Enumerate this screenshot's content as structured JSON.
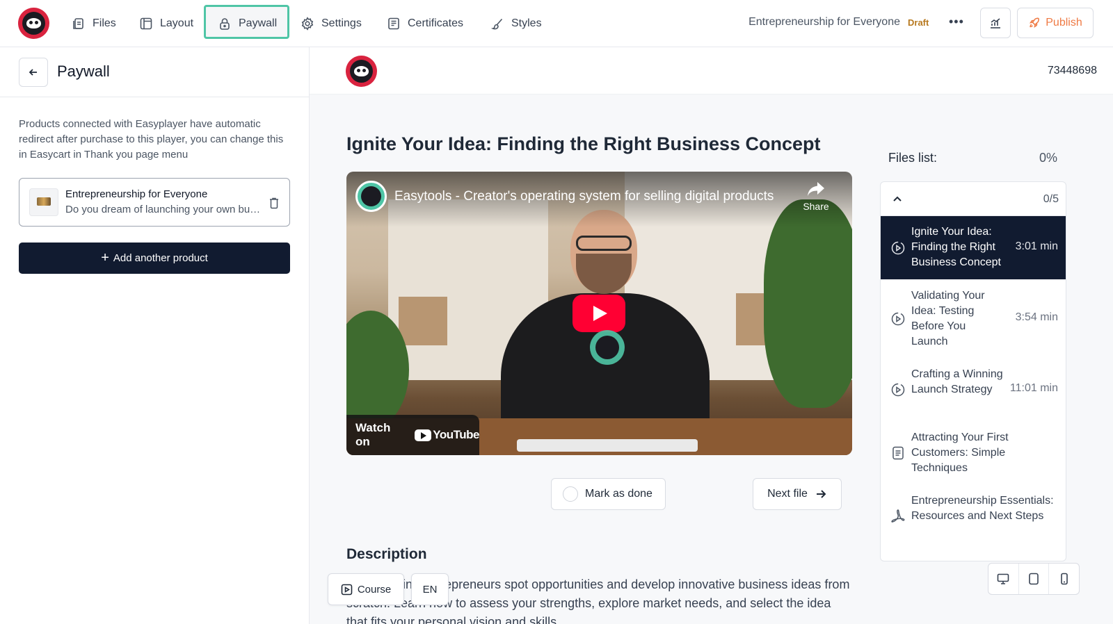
{
  "topbar": {
    "nav": [
      {
        "label": "Files",
        "icon": "files-icon"
      },
      {
        "label": "Layout",
        "icon": "layout-icon"
      },
      {
        "label": "Paywall",
        "icon": "lock-icon",
        "active": true
      },
      {
        "label": "Settings",
        "icon": "gear-icon"
      },
      {
        "label": "Certificates",
        "icon": "certificate-icon"
      },
      {
        "label": "Styles",
        "icon": "brush-icon"
      }
    ],
    "course_title": "Entrepreneurship for Everyone",
    "status_badge": "Draft",
    "more_label": "•••",
    "publish_label": "Publish",
    "accent_color": "#4fc5a6",
    "publish_color": "#ef7a44"
  },
  "left_panel": {
    "title": "Paywall",
    "info_text": "Products connected with Easyplayer have automatic redirect after purchase to this player, you can change this in Easycart in Thank you page menu",
    "product": {
      "name": "Entrepreneurship for Everyone",
      "description": "Do you dream of launching your own business and becoming an entrepreneur?"
    },
    "add_product_label": "Add another product",
    "add_product_plus": "+"
  },
  "preview": {
    "id": "73448698",
    "lesson_title": "Ignite Your Idea: Finding the Right Business Concept",
    "video": {
      "title": "Easytools - Creator's operating system for selling digital products",
      "share_label": "Share",
      "watch_on_label": "Watch on",
      "youtube_label": "YouTube"
    },
    "mark_done_label": "Mark as done",
    "next_file_label": "Next file",
    "description_title": "Description",
    "description_text": "Help aspiring entrepreneurs spot opportunities and develop innovative business ideas from scratch. Learn how to assess your strengths, explore market needs, and select the idea that fits your personal vision and skills.",
    "floating": {
      "course_label": "Course",
      "language_label": "EN"
    },
    "files": {
      "heading": "Files list:",
      "progress": "0%",
      "count": "0/5",
      "items": [
        {
          "name": "Ignite Your Idea: Finding the Right Business Concept",
          "duration": "3:01 min",
          "icon": "video-play-icon",
          "active": true
        },
        {
          "name": "Validating Your Idea: Testing Before You Launch",
          "duration": "3:54 min",
          "icon": "video-play-icon",
          "active": false
        },
        {
          "name": "Crafting a Winning Launch Strategy",
          "duration": "11:01 min",
          "icon": "video-play-icon",
          "active": false
        },
        {
          "name": "Attracting Your First Customers: Simple Techniques",
          "duration": "",
          "icon": "document-icon",
          "active": false
        },
        {
          "name": "Entrepreneurship Essentials: Resources and Next Steps",
          "duration": "",
          "icon": "pdf-icon",
          "active": false
        }
      ]
    },
    "device_icons": [
      "desktop-icon",
      "tablet-icon",
      "mobile-icon"
    ]
  }
}
